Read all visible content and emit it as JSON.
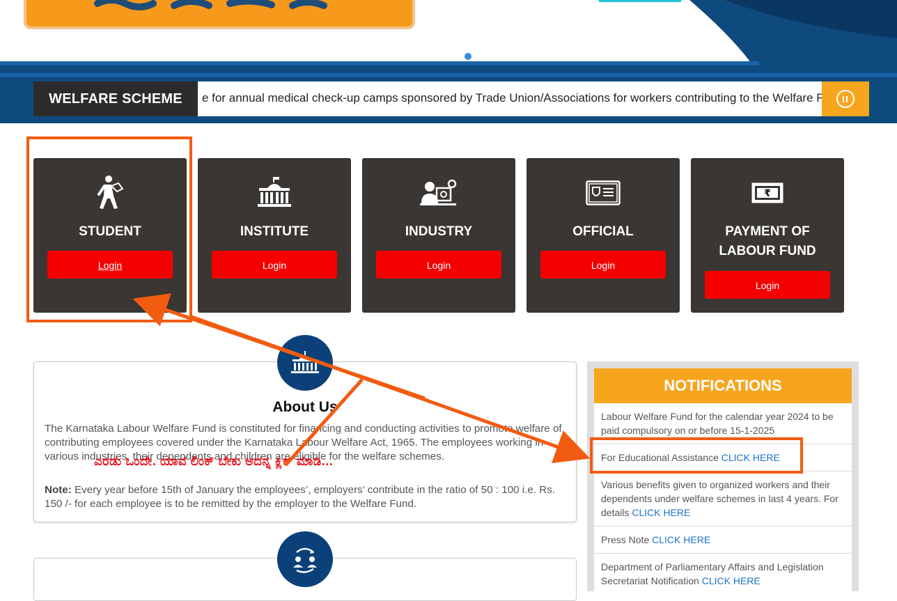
{
  "banner": {
    "carousel_dot": "carousel-dot"
  },
  "ticker": {
    "label": "WELFARE SCHEME",
    "text": "e for annual medical check-up camps sponsored by Trade Union/Associations for workers contributing to the Welfare Fund",
    "pause_icon": "pause-icon"
  },
  "cards": [
    {
      "title": "STUDENT",
      "login": "Login",
      "icon": "student-icon"
    },
    {
      "title": "INSTITUTE",
      "login": "Login",
      "icon": "institute-icon"
    },
    {
      "title": "INDUSTRY",
      "login": "Login",
      "icon": "industry-icon"
    },
    {
      "title": "OFFICIAL",
      "login": "Login",
      "icon": "official-id-icon"
    },
    {
      "title_line1": "PAYMENT OF",
      "title_line2": "LABOUR FUND",
      "login": "Login",
      "icon": "rupee-note-icon"
    }
  ],
  "about": {
    "title": "About Us",
    "text": "The Karnataka Labour Welfare Fund is constituted for financing and conducting activities to promote welfare of contributing employees covered under the Karnataka Labour Welfare Act, 1965. The employees working in various industries, their dependents and children are eligible for the welfare schemes.",
    "note_label": "Note:",
    "note_text": " Every year before 15th of January the employees’, employers’ contribute in the ratio of 50 : 100 i.e. Rs. 150 /- for each employee is to be remitted by the employer to the Welfare Fund."
  },
  "annotation": {
    "kannada_text": "ಎರಡು ಒಂದೇ. ಯಾವ ಲಿಂಕ್ ಬೇಕು ಅದನ್ನ ಕ್ಲಿಕ್ ಮಾಡಿ..."
  },
  "notifications": {
    "title": "NOTIFICATIONS",
    "items": [
      {
        "text": "Labour Welfare Fund for the calendar year 2024 to be paid compulsory on or before 15-1-2025",
        "link": ""
      },
      {
        "text": "For Educational Assistance ",
        "link": "CLICK HERE"
      },
      {
        "text": "Various benefits given to organized workers and their dependents under welfare schemes in last 4 years. For details ",
        "link": "CLICK HERE"
      },
      {
        "text": "Press Note ",
        "link": "CLICK HERE"
      },
      {
        "text": "Department of Parliamentary Affairs and Legislation Secretariat Notification ",
        "link": "CLICK HERE"
      }
    ]
  },
  "colors": {
    "card_bg": "#3a3633",
    "login_red": "#f40000",
    "accent_orange": "#f7a51d",
    "navy": "#0b4178",
    "annotation_orange": "#f25c10",
    "link_blue": "#1a73c8"
  }
}
